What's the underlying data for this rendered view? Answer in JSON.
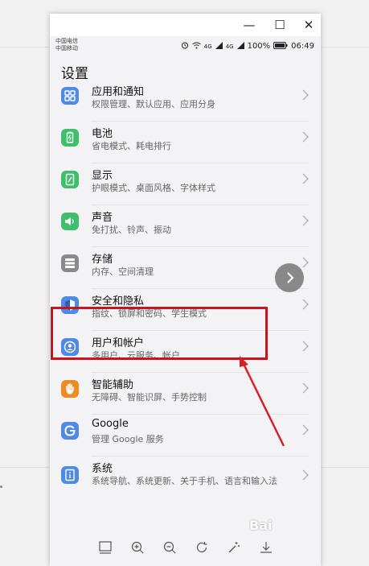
{
  "window": {
    "minimize": "—",
    "maximize": "☐",
    "close": "✕"
  },
  "status": {
    "carrier1": "中国电信",
    "carrier2": "中国移动",
    "net1": "4G",
    "net2": "4G",
    "battery": "100%",
    "time": "06:49"
  },
  "page_title": "设置",
  "items": [
    {
      "title": "应用和通知",
      "subtitle": "权限管理、默认应用、应用分身",
      "icon": "apps-grid-icon",
      "color": "#4f8ae6"
    },
    {
      "title": "电池",
      "subtitle": "省电模式、耗电排行",
      "icon": "battery-icon",
      "color": "#3fbf6b"
    },
    {
      "title": "显示",
      "subtitle": "护眼模式、桌面风格、字体样式",
      "icon": "display-icon",
      "color": "#3fbf6b"
    },
    {
      "title": "声音",
      "subtitle": "免打扰、铃声、振动",
      "icon": "sound-icon",
      "color": "#3fbf6b"
    },
    {
      "title": "存储",
      "subtitle": "内存、空间清理",
      "icon": "storage-icon",
      "color": "#8a8a8a"
    },
    {
      "title": "安全和隐私",
      "subtitle": "指纹、锁屏和密码、学生模式",
      "icon": "shield-icon",
      "color": "#4f8ae6"
    },
    {
      "title": "用户和帐户",
      "subtitle": "多用户、云服务、帐户",
      "icon": "user-icon",
      "color": "#4f8ae6"
    },
    {
      "title": "智能辅助",
      "subtitle": "无障碍、智能识屏、手势控制",
      "icon": "hand-icon",
      "color": "#f08a24"
    },
    {
      "title": "Google",
      "subtitle": "管理 Google 服务",
      "icon": "google-icon",
      "color": "#4f8ae6"
    },
    {
      "title": "系统",
      "subtitle": "系统导航、系统更新、关于手机、语言和输入法",
      "icon": "info-icon",
      "color": "#4f8ae6"
    }
  ],
  "toolbar": [
    "screen-icon",
    "zoom-in-icon",
    "zoom-out-icon",
    "rotate-icon",
    "magic-wand-icon",
    "download-icon"
  ],
  "watermark": "Bai"
}
